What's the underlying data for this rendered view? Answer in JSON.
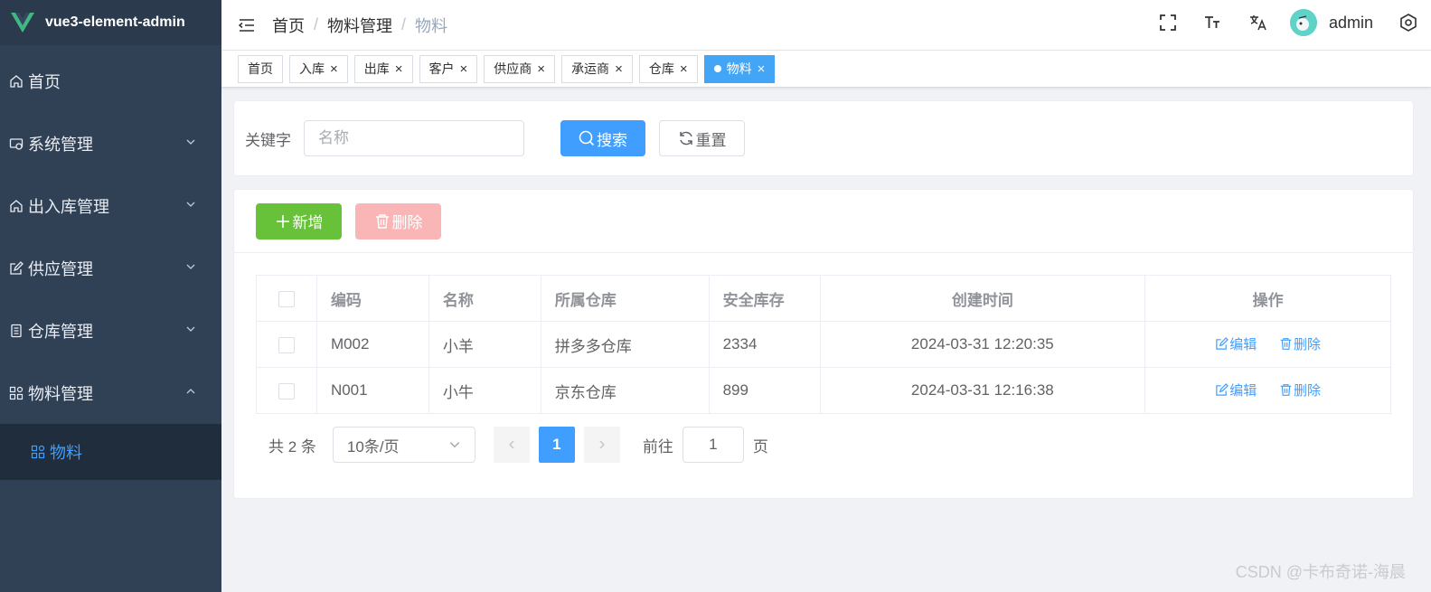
{
  "app": {
    "title": "vue3-element-admin"
  },
  "sidebar": {
    "items": [
      {
        "label": "首页",
        "icon": "home-icon"
      },
      {
        "label": "系统管理",
        "icon": "system-icon"
      },
      {
        "label": "出入库管理",
        "icon": "home-icon"
      },
      {
        "label": "供应管理",
        "icon": "edit-icon"
      },
      {
        "label": "仓库管理",
        "icon": "document-icon"
      },
      {
        "label": "物料管理",
        "icon": "grid-icon"
      }
    ],
    "subitems": [
      {
        "label": "物料",
        "icon": "grid-icon"
      }
    ],
    "active_color": "#409eff"
  },
  "header": {
    "breadcrumb": [
      "首页",
      "物料管理",
      "物料"
    ],
    "username": "admin"
  },
  "tags": [
    "首页",
    "入库",
    "出库",
    "客户",
    "供应商",
    "承运商",
    "仓库",
    "物料"
  ],
  "search": {
    "label": "关键字",
    "placeholder": "名称",
    "search_label": "搜索",
    "reset_label": "重置"
  },
  "toolbar": {
    "add_label": "新增",
    "delete_label": "删除"
  },
  "table": {
    "columns": [
      "编码",
      "名称",
      "所属仓库",
      "安全库存",
      "创建时间",
      "操作"
    ],
    "rows": [
      {
        "code": "M002",
        "name": "小羊",
        "warehouse": "拼多多仓库",
        "stock": "2334",
        "created": "2024-03-31 12:20:35"
      },
      {
        "code": "N001",
        "name": "小牛",
        "warehouse": "京东仓库",
        "stock": "899",
        "created": "2024-03-31 12:16:38"
      }
    ],
    "edit_label": "编辑",
    "delete_label": "删除"
  },
  "pagination": {
    "total_text": "共 2 条",
    "page_size": "10条/页",
    "current_page": "1",
    "goto_label": "前往",
    "goto_value": "1",
    "page_label": "页"
  },
  "watermark": "CSDN @卡布奇诺-海晨",
  "colors": {
    "primary": "#409eff",
    "success": "#67c23a",
    "danger_disabled": "#fab6b6",
    "sidebar_bg": "#304156"
  }
}
